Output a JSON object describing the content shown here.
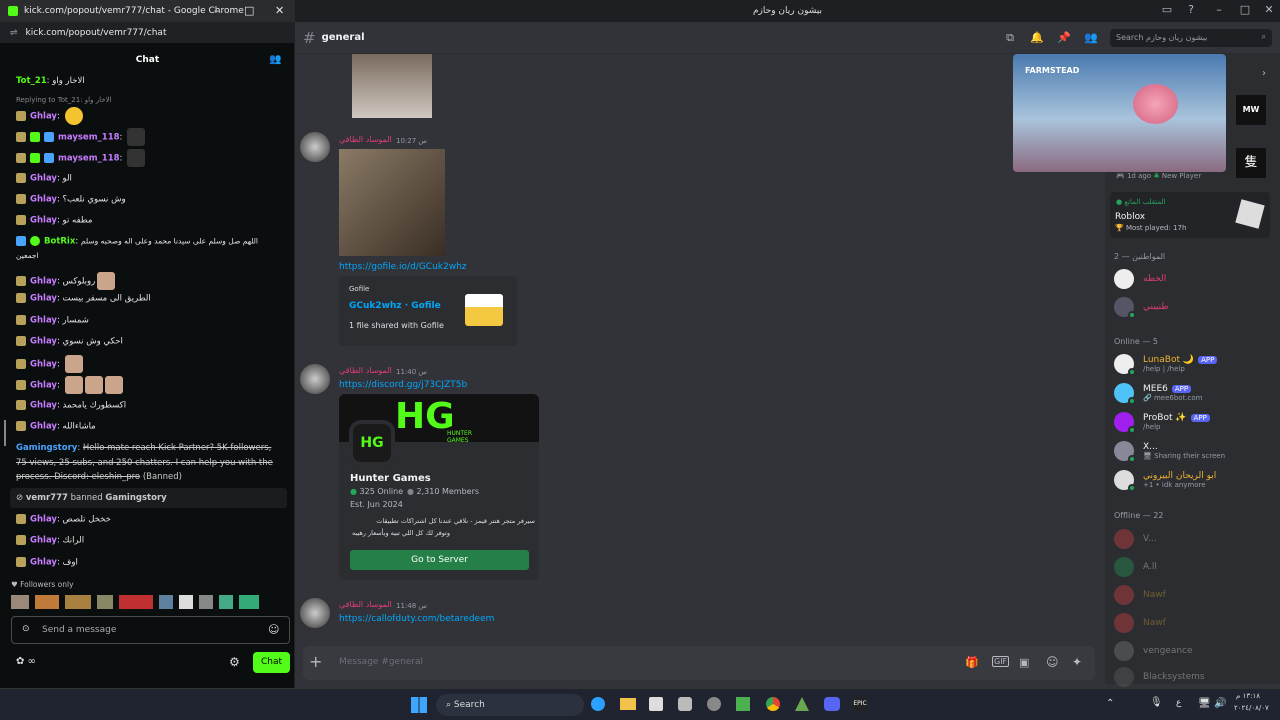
{
  "kick": {
    "window_title": "kick.com/popout/vemr777/chat - Google Chrome",
    "url": "kick.com/popout/vemr777/chat",
    "chat_header": "Chat",
    "messages": [
      {
        "user": "Tot_21",
        "text": "الاخار واو",
        "color": "#53fc18"
      },
      {
        "reply": "Replying to Tot_21: الاخار واو"
      },
      {
        "user": "Ghlay",
        "text": ""
      },
      {
        "user": "maysem_118",
        "text": ""
      },
      {
        "user": "maysem_118",
        "text": ""
      },
      {
        "user": "Ghlay",
        "text": "الو"
      },
      {
        "user": "Ghlay",
        "text": "وش نسوي نلعب؟"
      },
      {
        "user": "Ghlay",
        "text": "مطفه تو"
      },
      {
        "user": "BotRix",
        "text": "اللهم صل وسلم على سيدنا محمد وعلى اله وصحبه وسلم"
      },
      {
        "cont": "اجمعين"
      },
      {
        "user": "Ghlay",
        "text": "روبلوكس"
      },
      {
        "user": "Ghlay",
        "text": "الطريق الى مسفر بيست"
      },
      {
        "user": "Ghlay",
        "text": "شمسار"
      },
      {
        "user": "Ghlay",
        "text": "احكي وش نسوي"
      },
      {
        "user": "Ghlay",
        "text": ""
      },
      {
        "user": "Ghlay",
        "text": ""
      },
      {
        "user": "Ghlay",
        "text": "اكسطورك يامحمد"
      },
      {
        "user": "Ghlay",
        "text": "ماشاءالله"
      }
    ],
    "banned_msg": {
      "user": "Gamingstory",
      "text": "Hello mate reach Kick Partner? 5K followers, 75 views, 25 subs, and 250 chatters. I can help you with the process. Discord: eleshin_pro",
      "tag": "(Banned)",
      "line1": "Hello mate reach Kick Partner? 5K followers,",
      "line2": "75 views, 25 subs, and 250 chatters. I can help you with the",
      "line3": "process. Discord: eleshin_pro"
    },
    "ban_notice": {
      "moderator": "vemr777",
      "action": "banned",
      "target": "Gamingstory"
    },
    "after": [
      {
        "user": "Ghlay",
        "text": "خخخل تلصص"
      },
      {
        "user": "Ghlay",
        "text": "الرانك"
      },
      {
        "user": "Ghlay",
        "text": "اوف"
      }
    ],
    "followers_only": "Followers only",
    "input_placeholder": "Send a message",
    "chat_button": "Chat"
  },
  "discord": {
    "window_title": "بيشون ريان وحازم",
    "channel": "general",
    "search_placeholder": "Search بيشون ريان وحازم",
    "messages": [
      {
        "user": "الموساد الطاقي",
        "time": "س 10:27"
      },
      {
        "user": "الموساد الطاقي",
        "time": "س 11:40"
      },
      {
        "user": "الموساد الطاقي",
        "time": "س 11:48"
      }
    ],
    "gofile_link": "https://gofile.io/d/GCuk2whz",
    "gofile": {
      "provider": "Gofile",
      "title": "GCuk2whz · Gofile",
      "desc": "1 file shared with Gofile"
    },
    "discord_link": "https://discord.gg/j73CJZT5b",
    "hunter": {
      "name": "Hunter Games",
      "online": "325 Online",
      "members": "2,310 Members",
      "est": "Est. Jun 2024",
      "desc1": "سيرفر متجر هنتر قيمز - نلاقي عندنا كل اشتراكات تطبيقات",
      "desc2": "وتوفر لك كل اللي تبيه وبأسعار رهيبه",
      "button": "Go to Server",
      "banner_text": "HUNTER GAMES"
    },
    "cod_link": "https://callofduty.com/betaredeem",
    "composer_placeholder": "Message #general"
  },
  "members": {
    "activity_time": "1d ago",
    "activity_label": "New Player",
    "roblox_user": "المتقلب الماتع",
    "roblox_game": "Roblox",
    "roblox_played": "Most played: 17h",
    "group1": "المواطنين — 2",
    "citizens": [
      {
        "name": "الخطه"
      },
      {
        "name": "طنيبني"
      }
    ],
    "online_header": "Online — 5",
    "online": [
      {
        "name": "LunaBot",
        "sub": "/help | /help",
        "app": "APP",
        "color": "#f0b232"
      },
      {
        "name": "MEE6",
        "sub": "mee6bot.com",
        "app": "APP",
        "color": "#ffffff"
      },
      {
        "name": "ProBot",
        "sub": "/help",
        "app": "APP",
        "color": "#ffffff"
      },
      {
        "name": "X...",
        "sub": "Sharing their screen",
        "app": "",
        "color": "#ffffff"
      },
      {
        "name": "ابو الريحان البيروني",
        "sub": "+1 • idk anymore",
        "app": "",
        "color": "#f0b232"
      }
    ],
    "offline_header": "Offline — 22",
    "offline": [
      "V...",
      "A.ll",
      "Nawf",
      "Nawf",
      "vengeance",
      "Blacksystems"
    ]
  },
  "video": {
    "title": "FARMSTEAD"
  },
  "taskbar": {
    "search": "Search",
    "time": "١٣:١٨ م",
    "date": "٢٠٢٤/٠٨/٠٧",
    "lang": "ع"
  }
}
